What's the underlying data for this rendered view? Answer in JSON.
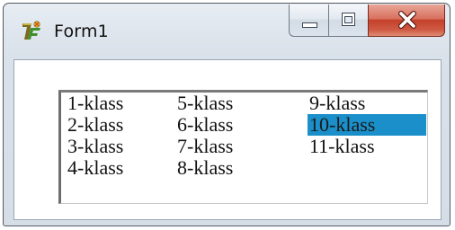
{
  "window": {
    "title": "Form1",
    "icon": "delphi-app-icon"
  },
  "caption_buttons": {
    "minimize": "minimize-icon",
    "maximize": "maximize-icon",
    "close": "close-icon",
    "close_color": "#c4412b"
  },
  "listbox": {
    "selection_color": "#1a8fc9",
    "columns": [
      {
        "items": [
          "1-klass",
          "2-klass",
          "3-klass",
          "4-klass"
        ]
      },
      {
        "items": [
          "5-klass",
          "6-klass",
          "7-klass",
          "8-klass"
        ]
      },
      {
        "items": [
          "9-klass",
          "10-klass",
          "11-klass"
        ]
      }
    ],
    "selected_item": "10-klass"
  }
}
